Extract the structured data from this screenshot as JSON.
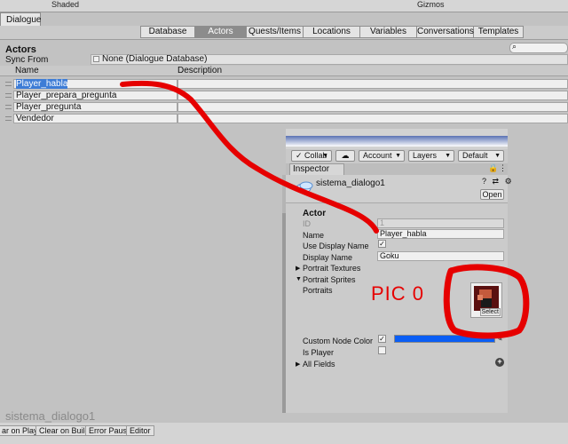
{
  "top_strip": {
    "shaded": "Shaded",
    "gizmos": "Gizmos"
  },
  "window_tab": "Dialogue",
  "tabs": [
    "Database",
    "Actors",
    "Quests/Items",
    "Locations",
    "Variables",
    "Conversations",
    "Templates"
  ],
  "active_tab": "Actors",
  "section": "Actors",
  "sync_from": {
    "label": "Sync From",
    "value": "None (Dialogue Database)"
  },
  "columns": {
    "name": "Name",
    "description": "Description"
  },
  "actors": [
    "Player_habla",
    "Player_prepara_pregunta",
    "Player_pregunta",
    "Vendedor"
  ],
  "watermark": "sistema_dialogo1",
  "status_bar": [
    "ar on Play",
    "Clear on Build",
    "Error Pause",
    "Editor"
  ],
  "toolbar": {
    "collab": "Collab",
    "account": "Account",
    "layers": "Layers",
    "layout": "Default"
  },
  "inspector": {
    "tab": "Inspector",
    "object_name": "sistema_dialogo1",
    "open_button": "Open",
    "section": "Actor",
    "fields": {
      "id_label": "ID",
      "id_value": "1",
      "name_label": "Name",
      "name_value": "Player_habla",
      "use_display_name_label": "Use Display Name",
      "use_display_name_checked": true,
      "display_name_label": "Display Name",
      "display_name_value": "Goku",
      "portrait_textures_label": "Portrait Textures",
      "portrait_sprites_label": "Portrait Sprites",
      "portraits_label": "Portraits",
      "select_label": "Select",
      "custom_node_color_label": "Custom Node Color",
      "custom_node_color_checked": true,
      "custom_node_color": "#0a5ef5",
      "is_player_label": "Is Player",
      "is_player_checked": false,
      "all_fields_label": "All Fields"
    }
  },
  "annotation": {
    "text": "PIC 0",
    "color": "#e60000"
  }
}
